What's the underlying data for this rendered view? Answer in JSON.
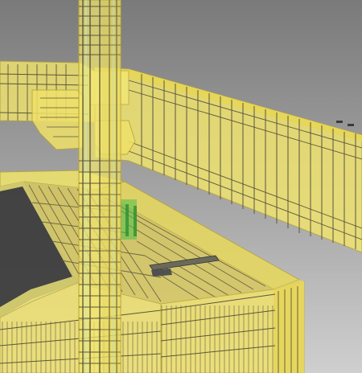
{
  "viewport": {
    "background_top": "#6f6f6f",
    "background_bottom": "#c8c8c8",
    "concrete_fill": "#f2e36a",
    "concrete_edge": "#c9b63a",
    "rebar_color": "#4a4a3a",
    "stirrup_color": "#5e5a40",
    "slab_shadow": "#3a3a3a",
    "embedded_part_color": "#3fbf3f"
  },
  "model": {
    "elements": [
      "column",
      "main-beam-left",
      "main-beam-right",
      "beam-haunch",
      "corbel",
      "slab-frame",
      "slab-front-edge-beam",
      "slab-right-edge-beam",
      "embedded-plate",
      "cast-in-channel"
    ]
  }
}
